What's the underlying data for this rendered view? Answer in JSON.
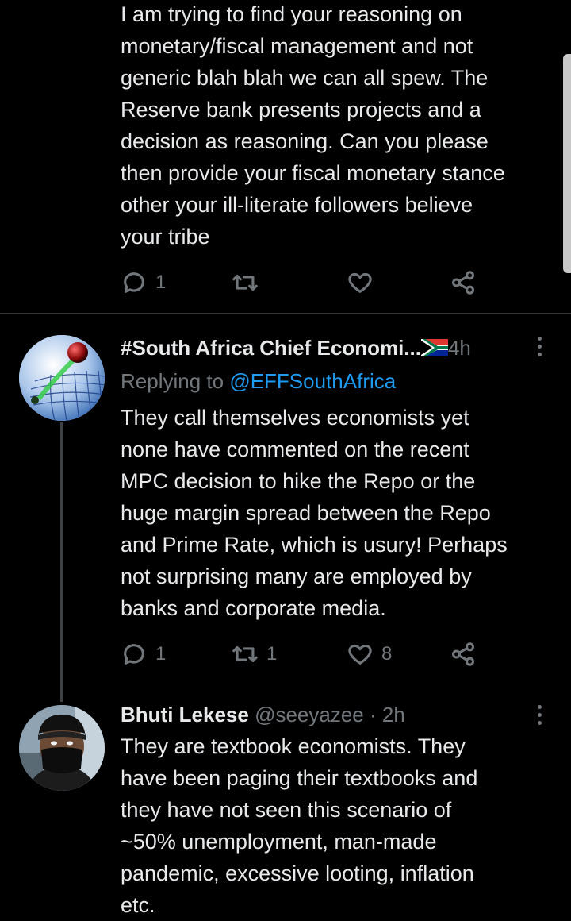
{
  "tweet1": {
    "text": "I am trying to find your reasoning on\nmonetary/fiscal management and not\ngeneric blah blah we can all spew. The\nReserve bank presents projects and a\ndecision as reasoning. Can you please\nthen provide your fiscal monetary stance\nother your ill-literate followers believe\nyour tribe",
    "reply_count": "1",
    "retweet_count": "",
    "like_count": ""
  },
  "tweet2": {
    "display_name": "#South Africa Chief Economi...",
    "flag_icon": "south-africa-flag-icon",
    "time": "4h",
    "replying_label": "Replying to",
    "replying_handle": "@EFFSouthAfrica",
    "text": "They call themselves economists yet\nnone have commented on the recent\nMPC decision to hike the Repo or the\nhuge margin spread between the Repo\nand Prime Rate, which is usury! Perhaps\nnot surprising many are employed by\nbanks and corporate media.",
    "reply_count": "1",
    "retweet_count": "1",
    "like_count": "8"
  },
  "tweet3": {
    "display_name": "Bhuti Lekese",
    "handle": "@seeyazee",
    "separator": "·",
    "time": "2h",
    "text": "They are textbook economists. They\nhave been paging their textbooks and\nthey have not seen this scenario of\n~50% unemployment, man-made\npandemic, excessive looting, inflation\netc."
  },
  "colors": {
    "background": "#000000",
    "text": "#e7e9ea",
    "muted": "#71767b",
    "link": "#1d9bf0",
    "divider": "#2f3336"
  }
}
